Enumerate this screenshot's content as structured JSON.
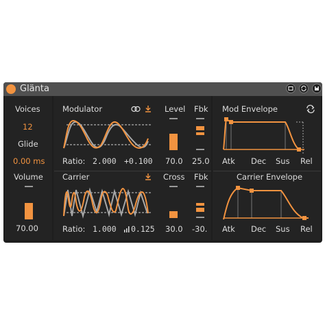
{
  "title": "Glänta",
  "colors": {
    "accent": "#f29340",
    "panel": "#232323",
    "text": "#dcdcdc",
    "trace": "#a8a8a8"
  },
  "left": {
    "voices_label": "Voices",
    "voices_value": "12",
    "glide_label": "Glide",
    "glide_value": "0.00 ms",
    "volume_label": "Volume",
    "volume_value": "70.00",
    "volume_level": 0.7
  },
  "modulator": {
    "label": "Modulator",
    "ratio_label": "Ratio:",
    "ratio_value": "2.000",
    "offset_value": "+0.100",
    "level_label": "Level",
    "level_value": "70.0",
    "level_amount": 0.7,
    "fbk_label": "Fbk",
    "fbk_value": "25.0"
  },
  "carrier": {
    "label": "Carrier",
    "ratio_label": "Ratio:",
    "ratio_value": "1.000",
    "offset_value": "0.125",
    "cross_label": "Cross",
    "cross_value": "30.0",
    "cross_amount": 0.3,
    "fbk_label": "Fbk",
    "fbk_value": "-30."
  },
  "mod_envelope": {
    "label": "Mod Envelope",
    "stages": [
      "Atk",
      "Dec",
      "Sus",
      "Rel"
    ]
  },
  "carrier_envelope": {
    "label": "Carrier Envelope",
    "stages": [
      "Atk",
      "Dec",
      "Sus",
      "Rel"
    ]
  },
  "icons": {
    "power": "power-icon",
    "modulator_link": "link-rings-icon",
    "download": "download-icon",
    "loop": "loop-icon"
  }
}
